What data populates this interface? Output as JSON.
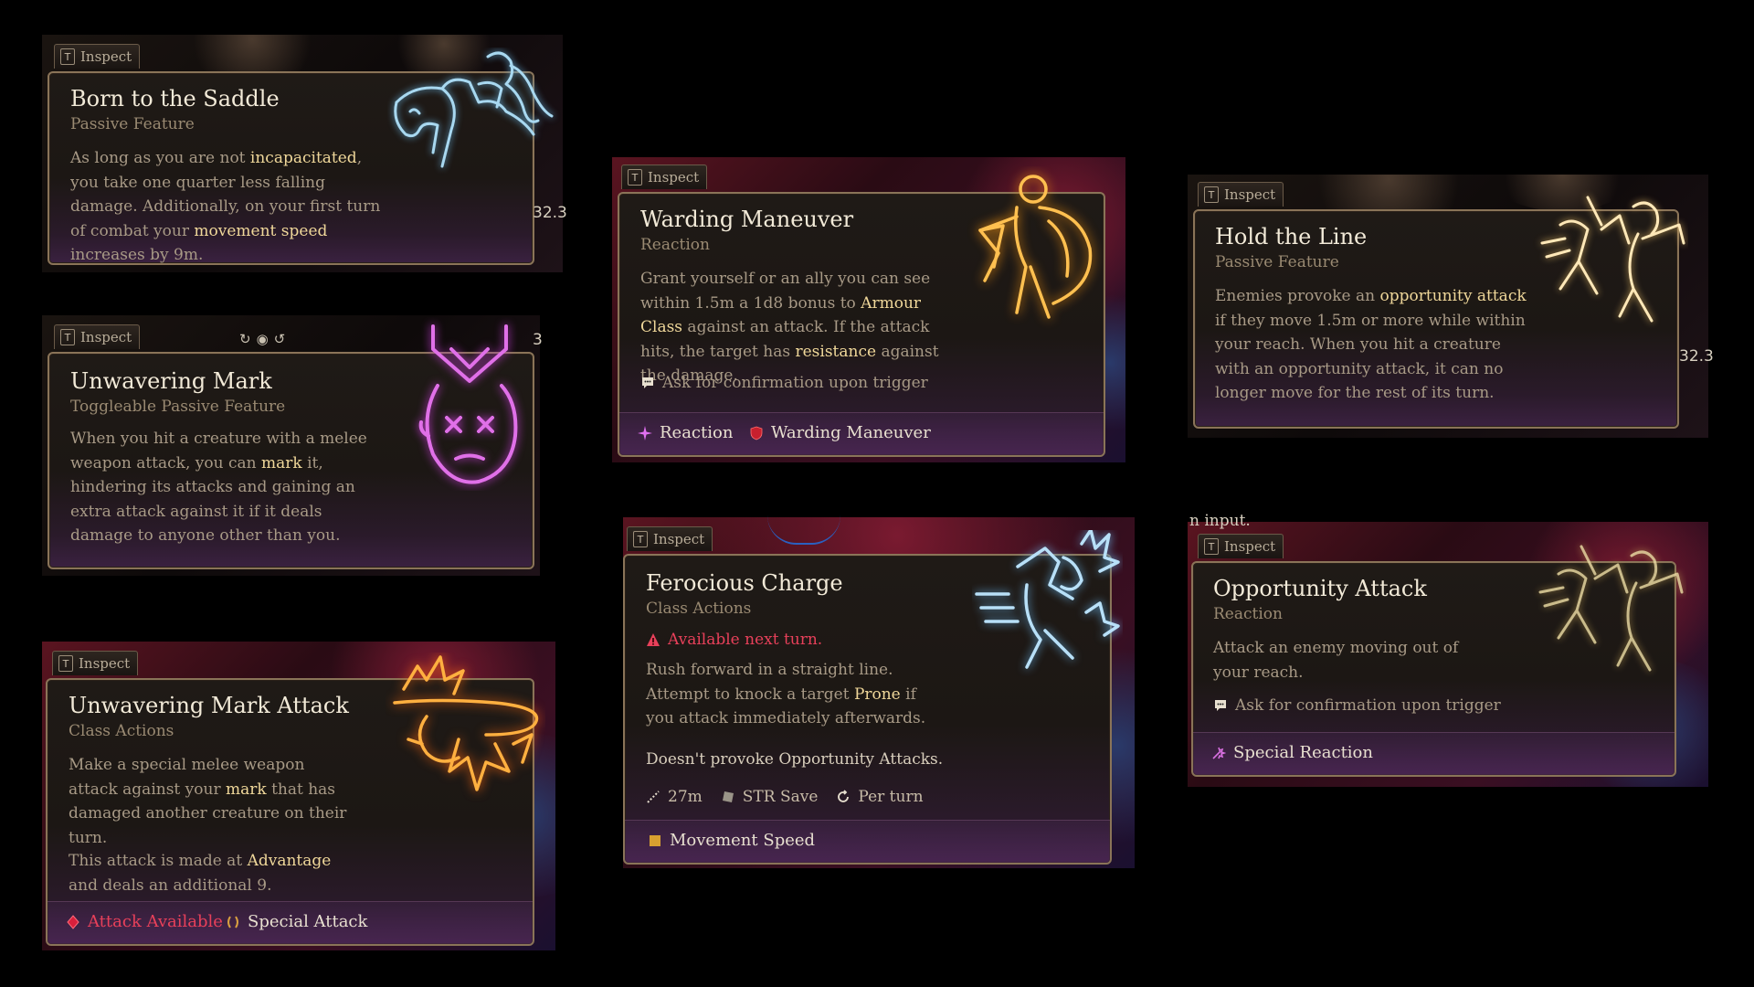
{
  "colors": {
    "highlight": "#f0d89a",
    "warning": "#e8405a",
    "border": "#8a7458",
    "title": "#f2ead8"
  },
  "inspect_key": "T",
  "inspect_label": "Inspect",
  "cards": {
    "born": {
      "title": "Born to the Saddle",
      "subtitle": "Passive Feature",
      "d1": "As long as you are not ",
      "d1b": "incapacitated",
      "d2": ", you take one quarter less falling damage. Additionally, on your first turn of combat your ",
      "d2b": "movement speed",
      "d3": " increases by 9m.",
      "side_number": "32.3",
      "icon": "rider-on-horse-icon"
    },
    "mark": {
      "title": "Unwavering Mark",
      "subtitle": "Toggleable Passive Feature",
      "d1": "When you hit a creature with a melee weapon attack, you can ",
      "d1b": "mark",
      "d2": " it, hindering its attacks and gaining an extra attack against it if it deals damage to anyone other than you.",
      "side_number": "3",
      "icon": "marked-face-icon"
    },
    "markattack": {
      "title": "Unwavering Mark Attack",
      "subtitle": "Class Actions",
      "d1": "Make a special melee weapon attack against your ",
      "d1b": "mark",
      "d2": " that has damaged another creature on their turn.",
      "d3": "This attack is made at ",
      "d3b": "Advantage",
      "d4": " and deals an additional 9.",
      "footer_a": "Attack Available",
      "footer_b": "Special Attack",
      "icon": "fiery-fist-icon"
    },
    "warding": {
      "title": "Warding Maneuver",
      "subtitle": "Reaction",
      "d1": "Grant yourself or an ally you can see within 1.5m a 1d8 bonus to ",
      "d1b": "Armour Class",
      "d2": " against an attack. If the attack hits, the target has ",
      "d2b": "resistance",
      "d3": " against the damage.",
      "confirm": "Ask for confirmation upon trigger",
      "footer_a": "Reaction",
      "footer_b": "Warding Maneuver",
      "icon": "shield-bearer-icon"
    },
    "ferocious": {
      "title": "Ferocious Charge",
      "subtitle": "Class Actions",
      "warning": "Available next turn.",
      "d1": "Rush forward in a straight line. Attempt to knock a target ",
      "d1b": "Prone",
      "d2": " if you attack immediately afterwards.",
      "note": "Doesn't provoke Opportunity Attacks.",
      "range": "27m",
      "save": "STR Save",
      "recharge": "Per turn",
      "footer_a": "Movement Speed",
      "icon": "charging-figure-icon"
    },
    "hold": {
      "title": "Hold the Line",
      "subtitle": "Passive Feature",
      "d1": "Enemies provoke an ",
      "d1b": "opportunity attack",
      "d2": " if they move 1.5m or more while within your reach. When you hit a creature with an opportunity attack, it can no longer move for the rest of its turn.",
      "side_number": "32.3",
      "icon": "duelists-icon"
    },
    "opportunity": {
      "title": "Opportunity Attack",
      "subtitle": "Reaction",
      "d1": "Attack an enemy moving out of your reach.",
      "confirm": "Ask for confirmation upon trigger",
      "footer_a": "Special Reaction",
      "top_fragment": "n input.",
      "icon": "duelists-icon"
    }
  }
}
